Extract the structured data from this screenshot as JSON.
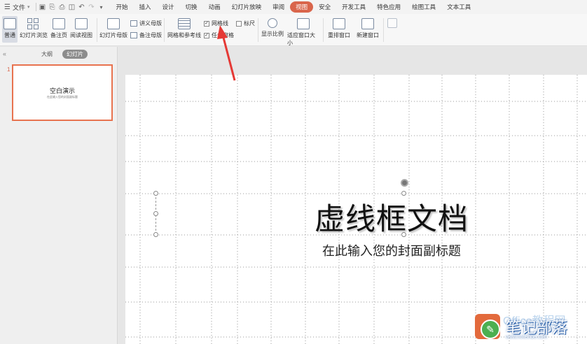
{
  "menu": {
    "file_label": "文件",
    "tabs": [
      "开始",
      "插入",
      "设计",
      "切换",
      "动画",
      "幻灯片放映",
      "审阅",
      "视图",
      "安全",
      "开发工具",
      "特色应用",
      "绘图工具",
      "文本工具"
    ],
    "active_tab": "视图"
  },
  "ribbon": {
    "normal": "普通",
    "slide_browse": "幻灯片浏览",
    "notes_page": "备注页",
    "reading_view": "阅读视图",
    "slide_master": "幻灯片母版",
    "handout_master": "讲义母版",
    "notes_master": "备注母版",
    "grid_guides": "网格和参考线",
    "gridlines": "网格线",
    "ruler": "标尺",
    "task_pane": "任务窗格",
    "zoom": "显示比例",
    "fit_window": "适应窗口大小",
    "arrange_window": "重排窗口",
    "new_window": "新建窗口"
  },
  "left_panel": {
    "tab_outline": "大纲",
    "tab_slides": "幻灯片",
    "slide_number": "1",
    "thumb_title": "空白演示",
    "thumb_subtitle": "在此输入您的封面副标题"
  },
  "slide": {
    "title": "虚线框文档",
    "subtitle": "在此输入您的封面副标题"
  },
  "watermark": {
    "name": "笔记部落",
    "site": "www.notetribe.com",
    "faint": "Office教程网"
  },
  "colors": {
    "accent": "#d9654b",
    "thumb_border": "#e8734f",
    "arrow": "#e53935"
  }
}
